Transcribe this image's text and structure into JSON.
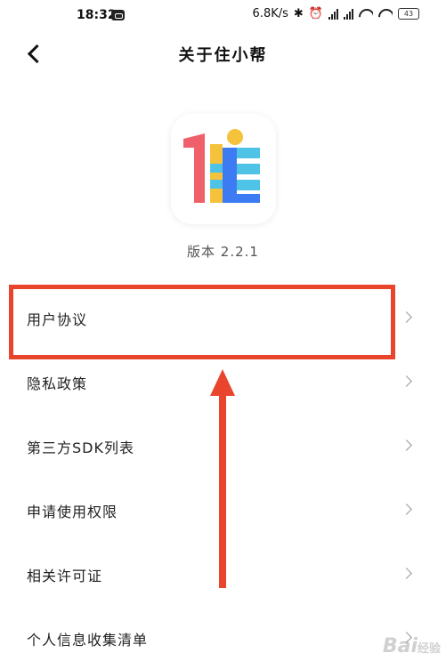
{
  "status_bar": {
    "time": "18:32",
    "network_speed": "6.8K/s",
    "battery": "43"
  },
  "header": {
    "title": "关于住小帮"
  },
  "app": {
    "version_text": "版本  2.2.1"
  },
  "menu": {
    "items": [
      {
        "label": "用户协议"
      },
      {
        "label": "隐私政策"
      },
      {
        "label": "第三方SDK列表"
      },
      {
        "label": "申请使用权限"
      },
      {
        "label": "相关许可证"
      },
      {
        "label": "个人信息收集清单"
      }
    ]
  },
  "watermark": {
    "brand": "Bai",
    "suffix": "经验"
  },
  "colors": {
    "annotation": "#e8452c",
    "logo_pink": "#f0606a",
    "logo_yellow": "#f5c33b",
    "logo_blue": "#3d7bf2",
    "logo_cyan": "#4fc3e6"
  }
}
